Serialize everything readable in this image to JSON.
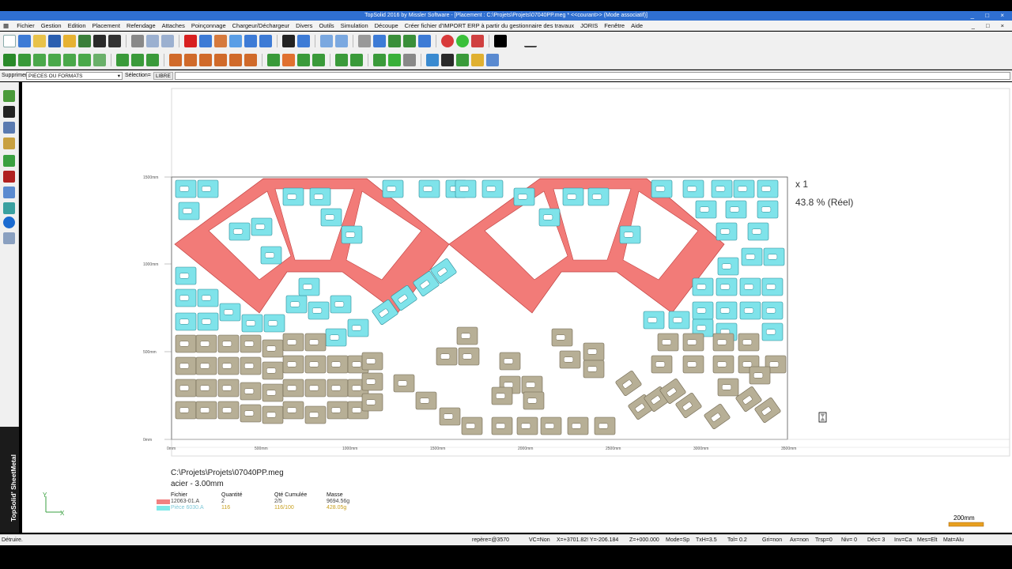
{
  "window": {
    "title": "TopSolid 2016 by Missler Software - [Placement : C:\\Projets\\Projets\\07040PP.meg *  <<courant>>  (Mode associatif)]",
    "controls": "_ □ ×",
    "mdi_controls": "_ □ ×"
  },
  "menu": [
    "Fichier",
    "Gestion",
    "Edition",
    "Placement",
    "Refendage",
    "Attaches",
    "Poinçonnage",
    "Chargeur/Déchargeur",
    "Divers",
    "Outils",
    "Simulation",
    "Découpe",
    "Créer fichier d'IMPORT ERP à partir du gestionnaire des travaux",
    "JORIS",
    "Fenêtre",
    "Aide"
  ],
  "selection_bar": {
    "delete_label": "Supprimer",
    "delete_value": "PIECES OU FORMATS",
    "selection_label": "Sélection=",
    "selection_value": "LIBRE"
  },
  "brand": "TopSolid' SheetMetal",
  "sheet": {
    "multiplier": "x 1",
    "utilization": "43.8 % (Réel)",
    "y_ticks": [
      "1500mm",
      "1000mm",
      "500mm",
      "0mm"
    ],
    "x_ticks": [
      "0mm",
      "500mm",
      "1000mm",
      "1500mm",
      "2000mm",
      "2500mm",
      "3000mm",
      "3500mm"
    ]
  },
  "file_info": {
    "path": "C:\\Projets\\Projets\\07040PP.meg",
    "material": "acier - 3.00mm",
    "headers": [
      "Fichier",
      "Quantité",
      "Qté Cumulée",
      "Masse"
    ],
    "rows": [
      {
        "file": "12063-01.A",
        "qty": "2",
        "cum": "2/5",
        "mass": "9694.56g",
        "color": "#f08080"
      },
      {
        "file": "Pièce 6030.A",
        "qty": "116",
        "cum": "116/100",
        "mass": "428.05g",
        "color": "#7ee8e8"
      }
    ]
  },
  "scale_bar": "200mm",
  "axes": {
    "x": "X",
    "y": "Y"
  },
  "status": {
    "message": "Détruire.",
    "items": [
      "repère=@3570",
      "VC=Non",
      "X=+3701.82! Y=-206.184",
      "Z=+000.000",
      "Mode=Sp",
      "TxH=3.5",
      "Tol=  0.2",
      "Gri=non",
      "Ax=non",
      "Trsp=0",
      "Niv=  0",
      "Déc= 3",
      "Inv=Ca",
      "Mes=Elt",
      "Mat=Alu"
    ]
  },
  "colors": {
    "part_red": "#f27b78",
    "part_cyan": "#7fe3ea",
    "part_khaki": "#b7af96",
    "titlebar": "#2f6fd1"
  }
}
